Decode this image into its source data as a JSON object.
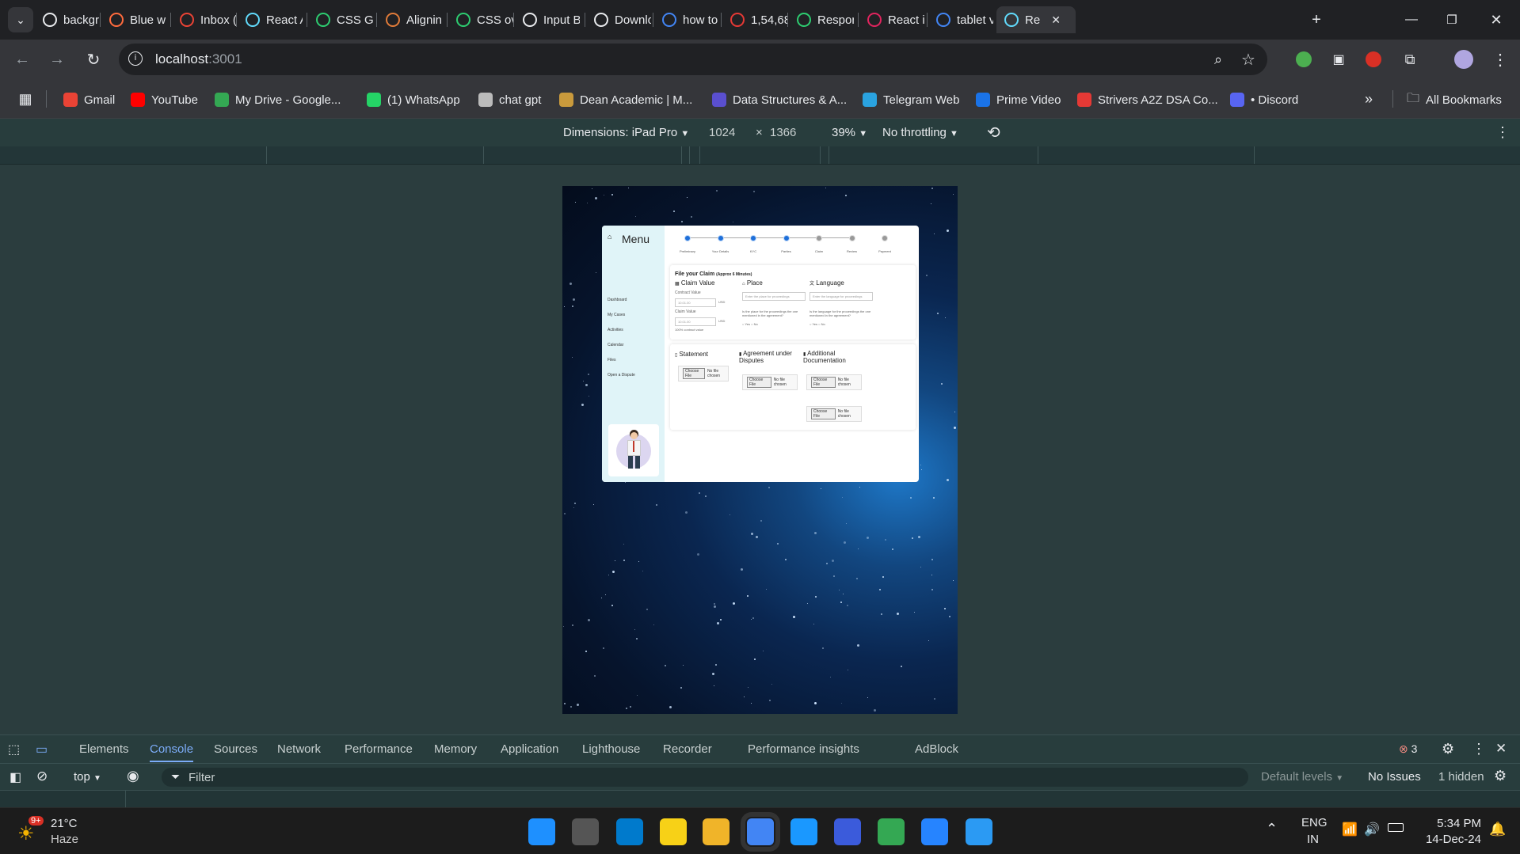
{
  "browser": {
    "tabs": [
      {
        "title": "backgr",
        "icon": "globe-icon",
        "color": "#e8eaed"
      },
      {
        "title": "Blue wh",
        "icon": "flame-icon",
        "color": "#ff6b3d"
      },
      {
        "title": "Inbox (",
        "icon": "gmail-icon",
        "color": "#ea4335"
      },
      {
        "title": "React A",
        "icon": "react-icon",
        "color": "#61dafb"
      },
      {
        "title": "CSS Gr",
        "icon": "w3-icon",
        "color": "#2dcc70"
      },
      {
        "title": "Alignin",
        "icon": "asterisk-icon",
        "color": "#e07b39"
      },
      {
        "title": "CSS ov",
        "icon": "w3-icon",
        "color": "#2dcc70"
      },
      {
        "title": "Input B",
        "icon": "chatgpt-icon",
        "color": "#e8eaed"
      },
      {
        "title": "Downlo",
        "icon": "download-icon",
        "color": "#e8eaed"
      },
      {
        "title": "how to",
        "icon": "google-icon",
        "color": "#4285f4"
      },
      {
        "title": "1,54,68",
        "icon": "red-app-icon",
        "color": "#e53935"
      },
      {
        "title": "Respon",
        "icon": "w3-icon",
        "color": "#2dcc70"
      },
      {
        "title": "React ic",
        "icon": "react-icon",
        "color": "#e0245e"
      },
      {
        "title": "tablet v",
        "icon": "google-icon",
        "color": "#4285f4"
      },
      {
        "title": "Re",
        "icon": "react-icon",
        "color": "#61dafb"
      }
    ],
    "url_host": "localhost",
    "url_port": ":3001",
    "bookmarks": [
      {
        "label": "Gmail",
        "icon": "gmail-icon",
        "color": "#ea4335"
      },
      {
        "label": "YouTube",
        "icon": "youtube-icon",
        "color": "#ff0000"
      },
      {
        "label": "My Drive - Google...",
        "icon": "drive-icon",
        "color": "#34a853"
      },
      {
        "label": "(1) WhatsApp",
        "icon": "whatsapp-icon",
        "color": "#25d366"
      },
      {
        "label": "chat gpt",
        "icon": "chatgpt-icon",
        "color": "#bbbbbb"
      },
      {
        "label": "Dean Academic | M...",
        "icon": "dean-icon",
        "color": "#c99a3c"
      },
      {
        "label": "Data Structures & A...",
        "icon": "ds-icon",
        "color": "#5a4fcf"
      },
      {
        "label": "Telegram Web",
        "icon": "telegram-icon",
        "color": "#2aa3e0"
      },
      {
        "label": "Prime Video",
        "icon": "prime-icon",
        "color": "#1a73e8"
      },
      {
        "label": "Strivers A2Z DSA Co...",
        "icon": "tuf-icon",
        "color": "#e53935"
      },
      {
        "label": "• Discord",
        "icon": "discord-icon",
        "color": "#5865f2"
      }
    ],
    "all_bookmarks": "All Bookmarks"
  },
  "devtools": {
    "dimensions_label": "Dimensions: iPad Pro",
    "width": "1024",
    "height": "1366",
    "zoom": "39%",
    "throttling": "No throttling",
    "tabs": [
      "Elements",
      "Console",
      "Sources",
      "Network",
      "Performance",
      "Memory",
      "Application",
      "Lighthouse",
      "Recorder",
      "Performance insights",
      "AdBlock"
    ],
    "active_tab": "Console",
    "error_count": "3",
    "context": "top",
    "filter_placeholder": "Filter",
    "levels": "Default levels",
    "issues": "No Issues",
    "hidden": "1 hidden"
  },
  "page": {
    "menu_title": "Menu",
    "side_links": [
      "Dashboard",
      "My Cases",
      "Activities",
      "Calendar",
      "Files",
      "Open a Dispute"
    ],
    "steps": [
      {
        "label": "Preliminary",
        "done": true
      },
      {
        "label": "Your Details",
        "done": true
      },
      {
        "label": "KYC",
        "done": true
      },
      {
        "label": "Parties",
        "done": true
      },
      {
        "label": "Claim",
        "done": false
      },
      {
        "label": "Review",
        "done": false
      },
      {
        "label": "Payment",
        "done": false
      }
    ],
    "claim_title": "File your Claim",
    "claim_subtitle": "(Approx 6 Minutes)",
    "claim_value_heading": "Claim Value",
    "place_heading": "Place",
    "language_heading": "Language",
    "contract_value_label": "Contract Value",
    "contract_value_input": "10.01.00",
    "currency": "USD",
    "claim_value_label": "Claim Value",
    "claim_value_input": "10.01.00",
    "claim_value_note": "100% contract value",
    "place_placeholder": "Enter the place for proceedings",
    "language_placeholder": "Enter the language for proceedings",
    "place_question": "Is the place for the proceedings the one mentioned in the agreement?",
    "language_question": "Is the language for the proceedings the one mentioned in the agreement?",
    "yes": "Yes",
    "no": "No",
    "statement_heading": "Statement",
    "agreement_heading": "Agreement under Disputes",
    "additional_heading": "Additional Documentation",
    "choose_file": "Choose File",
    "no_file": "No file chosen"
  },
  "taskbar": {
    "temperature": "21°C",
    "weather": "Haze",
    "weather_badge": "9+",
    "language": "ENG",
    "region": "IN",
    "time": "5:34 PM",
    "date": "14-Dec-24"
  }
}
